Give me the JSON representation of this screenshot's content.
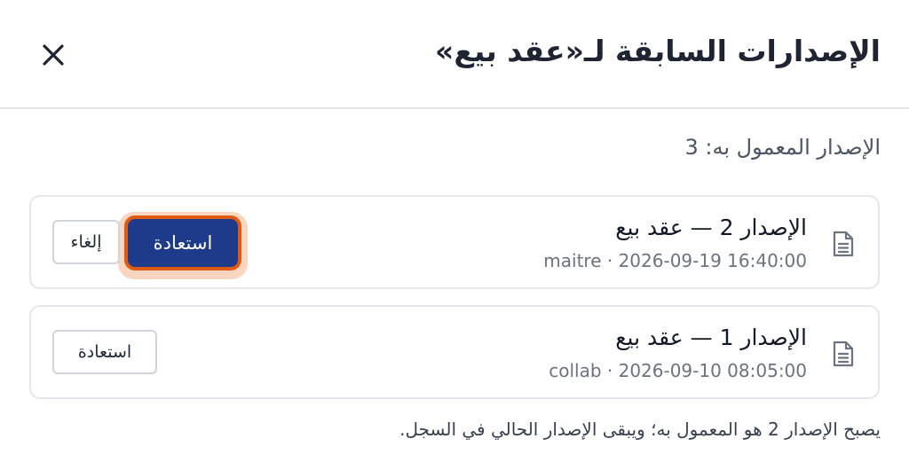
{
  "dialog": {
    "title": "الإصدارات السابقة لـ«عقد بيع»",
    "close_icon": "close-icon",
    "current_version_text": "الإصدار المعمول به: 3"
  },
  "versions": [
    {
      "title": "الإصدار 2 — عقد بيع",
      "meta": "maitre · 2026-09-19 16:40:00",
      "icon": "document-icon",
      "actions": {
        "restore_label": "استعادة",
        "cancel_label": "إلغاء"
      },
      "restore_focused": true
    },
    {
      "title": "الإصدار 1 — عقد بيع",
      "meta": "collab · 2026-09-10 08:05:00",
      "icon": "document-icon",
      "actions": {
        "restore_label": "استعادة"
      }
    }
  ],
  "footer_note": "يصبح الإصدار 2 هو المعمول به؛ ويبقى الإصدار الحالي في السجل.",
  "colors": {
    "primary": "#1e3a8a",
    "focus_ring": "#e15a14",
    "focus_halo": "#fad6c1",
    "border": "#e5e7eb"
  }
}
